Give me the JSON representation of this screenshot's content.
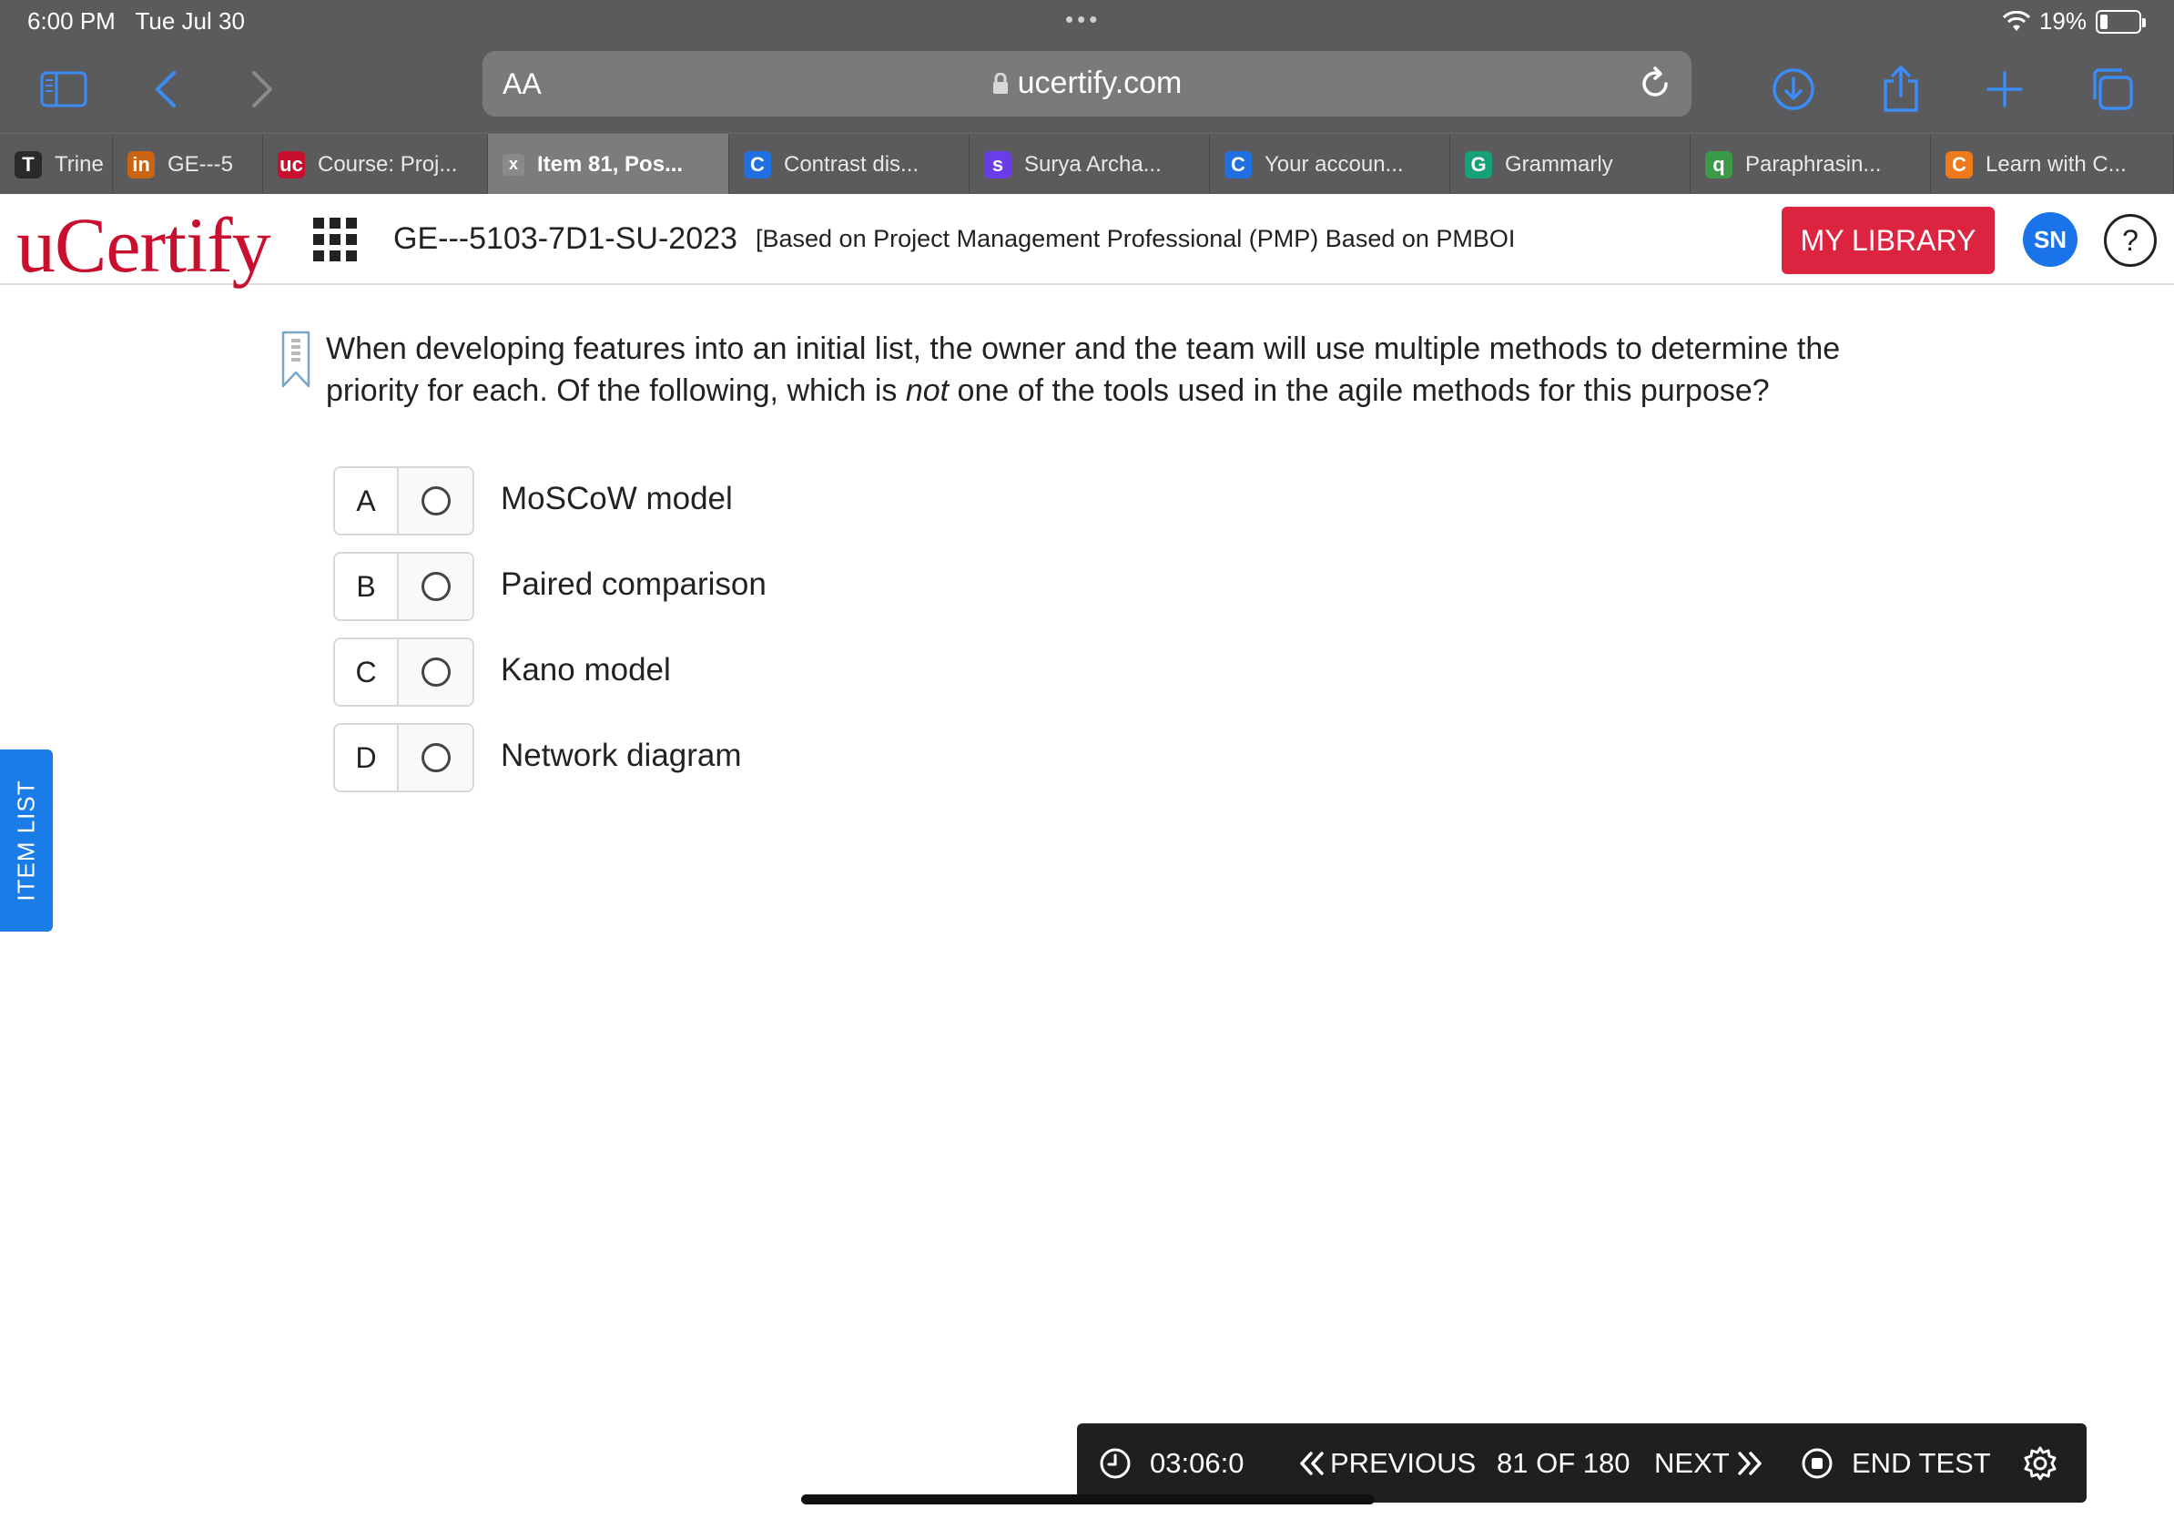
{
  "status_bar": {
    "time": "6:00 PM",
    "date": "Tue Jul 30",
    "battery": "19%",
    "battery_level": 0.19
  },
  "browser": {
    "text_size_button": "AA",
    "url": "ucertify.com",
    "tabs": [
      {
        "label": "Trine",
        "icon": "T",
        "color": "#2a2a2a"
      },
      {
        "label": "GE---5",
        "icon": "in",
        "color": "#c86414"
      },
      {
        "label": "Course: Proj...",
        "icon": "uc",
        "color": "#c8102e"
      },
      {
        "label": "Item 81, Pos...",
        "icon": "x",
        "color": "#8a8a8a",
        "active": true
      },
      {
        "label": "Contrast dis...",
        "icon": "C",
        "color": "#1f6fe0"
      },
      {
        "label": "Surya Archa...",
        "icon": "s",
        "color": "#6a3de8"
      },
      {
        "label": "Your accoun...",
        "icon": "C",
        "color": "#1f6fe0"
      },
      {
        "label": "Grammarly",
        "icon": "G",
        "color": "#15a176"
      },
      {
        "label": "Paraphrasin...",
        "icon": "q",
        "color": "#3a9a48"
      },
      {
        "label": "Learn with C...",
        "icon": "C",
        "color": "#ef7a1a"
      }
    ]
  },
  "header": {
    "logo": "uCertify",
    "course_code": "GE---5103-7D1-SU-2023",
    "course_title": "[Based on Project Management Professional (PMP) Based on PMBOI",
    "my_library": "MY LIBRARY",
    "avatar_initials": "SN",
    "help": "?"
  },
  "question": {
    "text_before": "When developing features into an initial list, the owner and the team will use multiple methods to determine the priority for each. Of the following, which is ",
    "text_emphasis": "not",
    "text_after": " one of the tools used in the agile methods for this purpose?",
    "options": [
      {
        "letter": "A",
        "text": "MoSCoW model"
      },
      {
        "letter": "B",
        "text": "Paired comparison"
      },
      {
        "letter": "C",
        "text": "Kano model"
      },
      {
        "letter": "D",
        "text": "Network diagram"
      }
    ]
  },
  "side_tab": {
    "label": "ITEM LIST"
  },
  "bottom_bar": {
    "timer": "03:06:0",
    "previous": "PREVIOUS",
    "position": "81 OF 180",
    "next": "NEXT",
    "end_test": "END TEST"
  },
  "colors": {
    "brand_red": "#c8102e",
    "library_red": "#dc2440",
    "accent_blue": "#1a7ce6",
    "toolbar_blue": "#3b8cf5"
  }
}
